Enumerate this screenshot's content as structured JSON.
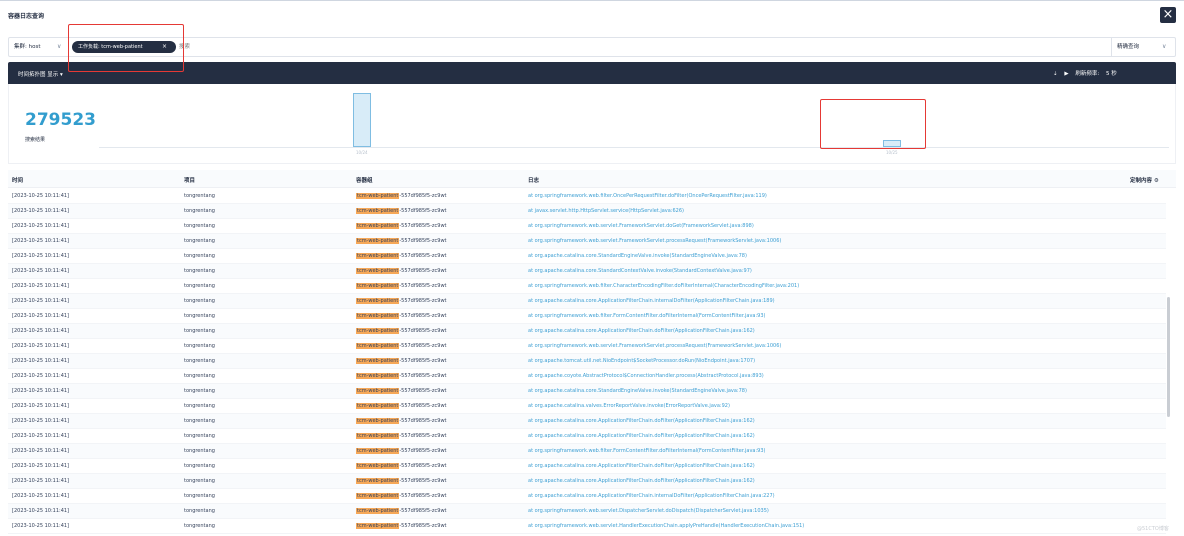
{
  "header": {
    "title": "容器日志查询",
    "close_icon": "×"
  },
  "filter": {
    "cluster_label": "集群: host",
    "tag_label": "工作负载: tcm-web-patient",
    "tag_close": "×",
    "search_placeholder": "搜索",
    "match_mode": "精确查询"
  },
  "toolbar": {
    "histogram_toggle": "时间拓扑图 显示 ▾",
    "download_icon": "⇣",
    "play_icon": "▶",
    "refresh_label": "刷新频率:",
    "refresh_value": "5 秒"
  },
  "summary": {
    "count": "279523",
    "label": "搜索结果"
  },
  "histogram": {
    "bars": [
      {
        "label": "10/24",
        "value": 1.0
      },
      {
        "label": "10/25",
        "value": 0.13
      }
    ]
  },
  "table": {
    "columns": {
      "time": "时间",
      "project": "项目",
      "container": "容器组",
      "log": "日志",
      "custom": "定制内容 ⚙"
    },
    "rows": [
      {
        "time": "[2023-10-25 10:11:41]",
        "project": "tongrentang",
        "container_hl": "tcm-web-patient",
        "container_rest": "-557df985f5-zc9wt",
        "log": "at org.springframework.web.filter.OncePerRequestFilter.doFilter(OncePerRequestFilter.java:119)"
      },
      {
        "time": "[2023-10-25 10:11:41]",
        "project": "tongrentang",
        "container_hl": "tcm-web-patient",
        "container_rest": "-557df985f5-zc9wt",
        "log": "at javax.servlet.http.HttpServlet.service(HttpServlet.java:626)"
      },
      {
        "time": "[2023-10-25 10:11:41]",
        "project": "tongrentang",
        "container_hl": "tcm-web-patient",
        "container_rest": "-557df985f5-zc9wt",
        "log": "at org.springframework.web.servlet.FrameworkServlet.doGet(FrameworkServlet.java:898)"
      },
      {
        "time": "[2023-10-25 10:11:41]",
        "project": "tongrentang",
        "container_hl": "tcm-web-patient",
        "container_rest": "-557df985f5-zc9wt",
        "log": "at org.springframework.web.servlet.FrameworkServlet.processRequest(FrameworkServlet.java:1006)"
      },
      {
        "time": "[2023-10-25 10:11:41]",
        "project": "tongrentang",
        "container_hl": "tcm-web-patient",
        "container_rest": "-557df985f5-zc9wt",
        "log": "at org.apache.catalina.core.StandardEngineValve.invoke(StandardEngineValve.java:78)"
      },
      {
        "time": "[2023-10-25 10:11:41]",
        "project": "tongrentang",
        "container_hl": "tcm-web-patient",
        "container_rest": "-557df985f5-zc9wt",
        "log": "at org.apache.catalina.core.StandardContextValve.invoke(StandardContextValve.java:97)"
      },
      {
        "time": "[2023-10-25 10:11:41]",
        "project": "tongrentang",
        "container_hl": "tcm-web-patient",
        "container_rest": "-557df985f5-zc9wt",
        "log": "at org.springframework.web.filter.CharacterEncodingFilter.doFilterInternal(CharacterEncodingFilter.java:201)"
      },
      {
        "time": "[2023-10-25 10:11:41]",
        "project": "tongrentang",
        "container_hl": "tcm-web-patient",
        "container_rest": "-557df985f5-zc9wt",
        "log": "at org.apache.catalina.core.ApplicationFilterChain.internalDoFilter(ApplicationFilterChain.java:189)"
      },
      {
        "time": "[2023-10-25 10:11:41]",
        "project": "tongrentang",
        "container_hl": "tcm-web-patient",
        "container_rest": "-557df985f5-zc9wt",
        "log": "at org.springframework.web.filter.FormContentFilter.doFilterInternal(FormContentFilter.java:93)"
      },
      {
        "time": "[2023-10-25 10:11:41]",
        "project": "tongrentang",
        "container_hl": "tcm-web-patient",
        "container_rest": "-557df985f5-zc9wt",
        "log": "at org.apache.catalina.core.ApplicationFilterChain.doFilter(ApplicationFilterChain.java:162)"
      },
      {
        "time": "[2023-10-25 10:11:41]",
        "project": "tongrentang",
        "container_hl": "tcm-web-patient",
        "container_rest": "-557df985f5-zc9wt",
        "log": "at org.springframework.web.servlet.FrameworkServlet.processRequest(FrameworkServlet.java:1006)"
      },
      {
        "time": "[2023-10-25 10:11:41]",
        "project": "tongrentang",
        "container_hl": "tcm-web-patient",
        "container_rest": "-557df985f5-zc9wt",
        "log": "at org.apache.tomcat.util.net.NioEndpoint$SocketProcessor.doRun(NioEndpoint.java:1707)"
      },
      {
        "time": "[2023-10-25 10:11:41]",
        "project": "tongrentang",
        "container_hl": "tcm-web-patient",
        "container_rest": "-557df985f5-zc9wt",
        "log": "at org.apache.coyote.AbstractProtocol$ConnectionHandler.process(AbstractProtocol.java:893)"
      },
      {
        "time": "[2023-10-25 10:11:41]",
        "project": "tongrentang",
        "container_hl": "tcm-web-patient",
        "container_rest": "-557df985f5-zc9wt",
        "log": "at org.apache.catalina.core.StandardEngineValve.invoke(StandardEngineValve.java:78)"
      },
      {
        "time": "[2023-10-25 10:11:41]",
        "project": "tongrentang",
        "container_hl": "tcm-web-patient",
        "container_rest": "-557df985f5-zc9wt",
        "log": "at org.apache.catalina.valves.ErrorReportValve.invoke(ErrorReportValve.java:92)"
      },
      {
        "time": "[2023-10-25 10:11:41]",
        "project": "tongrentang",
        "container_hl": "tcm-web-patient",
        "container_rest": "-557df985f5-zc9wt",
        "log": "at org.apache.catalina.core.ApplicationFilterChain.doFilter(ApplicationFilterChain.java:162)"
      },
      {
        "time": "[2023-10-25 10:11:41]",
        "project": "tongrentang",
        "container_hl": "tcm-web-patient",
        "container_rest": "-557df985f5-zc9wt",
        "log": "at org.apache.catalina.core.ApplicationFilterChain.doFilter(ApplicationFilterChain.java:162)"
      },
      {
        "time": "[2023-10-25 10:11:41]",
        "project": "tongrentang",
        "container_hl": "tcm-web-patient",
        "container_rest": "-557df985f5-zc9wt",
        "log": "at org.springframework.web.filter.FormContentFilter.doFilterInternal(FormContentFilter.java:93)"
      },
      {
        "time": "[2023-10-25 10:11:41]",
        "project": "tongrentang",
        "container_hl": "tcm-web-patient",
        "container_rest": "-557df985f5-zc9wt",
        "log": "at org.apache.catalina.core.ApplicationFilterChain.doFilter(ApplicationFilterChain.java:162)"
      },
      {
        "time": "[2023-10-25 10:11:41]",
        "project": "tongrentang",
        "container_hl": "tcm-web-patient",
        "container_rest": "-557df985f5-zc9wt",
        "log": "at org.apache.catalina.core.ApplicationFilterChain.doFilter(ApplicationFilterChain.java:162)"
      },
      {
        "time": "[2023-10-25 10:11:41]",
        "project": "tongrentang",
        "container_hl": "tcm-web-patient",
        "container_rest": "-557df985f5-zc9wt",
        "log": "at org.apache.catalina.core.ApplicationFilterChain.internalDoFilter(ApplicationFilterChain.java:227)"
      },
      {
        "time": "[2023-10-25 10:11:41]",
        "project": "tongrentang",
        "container_hl": "tcm-web-patient",
        "container_rest": "-557df985f5-zc9wt",
        "log": "at org.springframework.web.servlet.DispatcherServlet.doDispatch(DispatcherServlet.java:1035)"
      },
      {
        "time": "[2023-10-25 10:11:41]",
        "project": "tongrentang",
        "container_hl": "tcm-web-patient",
        "container_rest": "-557df985f5-zc9wt",
        "log": "at org.springframework.web.servlet.HandlerExecutionChain.applyPreHandle(HandlerExecutionChain.java:151)"
      }
    ]
  },
  "watermark": "@51CTO博客",
  "colors": {
    "dark": "#242e42",
    "accent": "#329dce",
    "highlight": "#f6a858",
    "annotation": "#e53935"
  }
}
